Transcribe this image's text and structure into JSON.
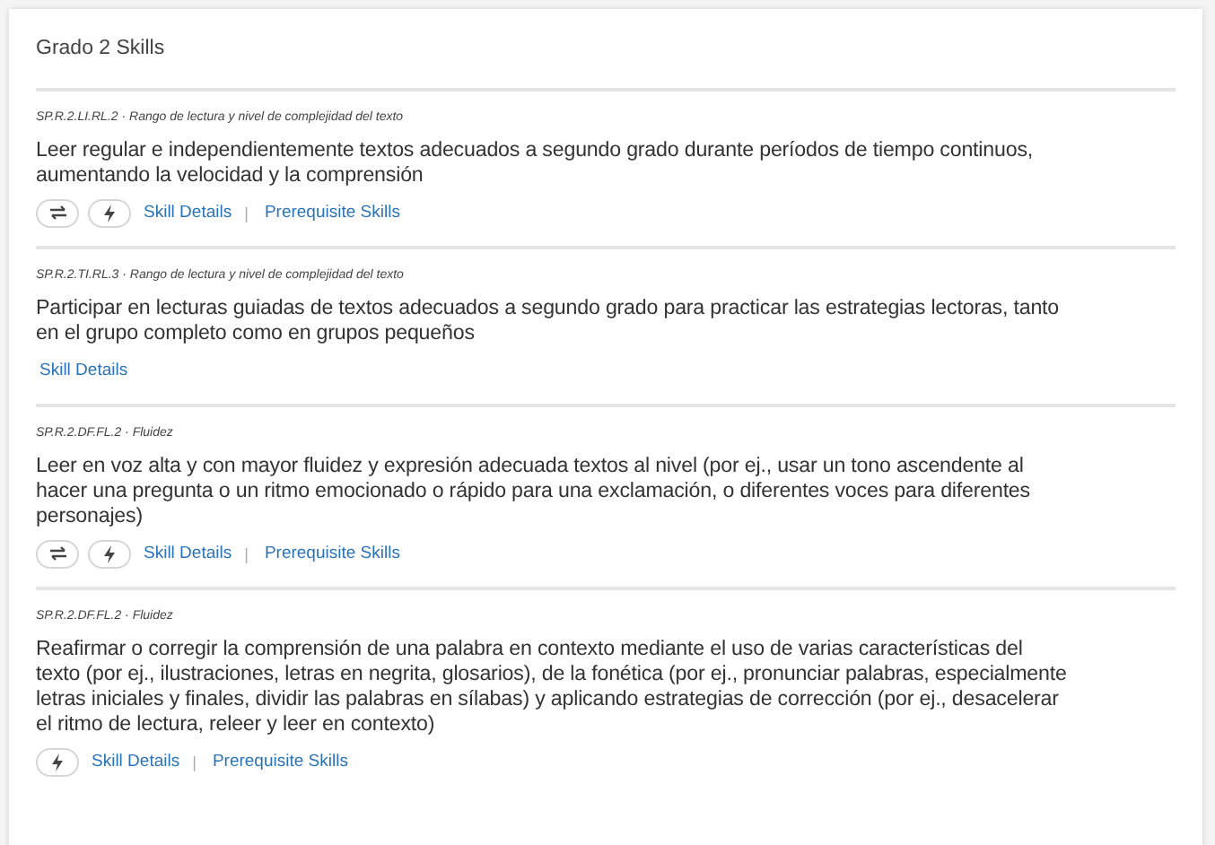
{
  "title": "Grado 2 Skills",
  "skills": [
    {
      "code": "SP.R.2.LI.RL.2 · Rango de lectura y nivel de complejidad del texto",
      "lines": [
        "Leer regular e independientemente textos adecuados a segundo grado durante períodos de tiempo continuos,",
        "aumentando la velocidad y la comprensión"
      ],
      "actions": [
        {
          "kind": "swap"
        },
        {
          "kind": "bolt"
        },
        {
          "kind": "link",
          "text": "Skill Details"
        },
        {
          "kind": "separator",
          "text": "|"
        },
        {
          "kind": "link",
          "text": "Prerequisite Skills"
        }
      ]
    },
    {
      "code": "SP.R.2.TI.RL.3 · Rango de lectura y nivel de complejidad del texto",
      "lines": [
        "Participar en lecturas guiadas de textos adecuados a segundo grado para practicar las estrategias lectoras, tanto",
        "en el grupo completo como en grupos pequeños"
      ],
      "actions": [
        {
          "kind": "link",
          "text": "Skill Details"
        }
      ]
    },
    {
      "code": "SP.R.2.DF.FL.2 · Fluidez",
      "lines": [
        "Leer en voz alta y con mayor fluidez y expresión adecuada textos al nivel (por ej., usar un tono ascendente al",
        "hacer una pregunta o un ritmo emocionado o rápido para una exclamación, o diferentes voces para diferentes",
        "personajes)"
      ],
      "actions": [
        {
          "kind": "swap"
        },
        {
          "kind": "bolt"
        },
        {
          "kind": "link",
          "text": "Skill Details"
        },
        {
          "kind": "separator",
          "text": "|"
        },
        {
          "kind": "link",
          "text": "Prerequisite Skills"
        }
      ]
    },
    {
      "code": "SP.R.2.DF.FL.2 · Fluidez",
      "lines": [
        "Reafirmar o corregir la comprensión de una palabra en contexto mediante el uso de varias características del",
        "texto (por ej., ilustraciones, letras en negrita, glosarios), de la fonética (por ej., pronunciar palabras, especialmente",
        "letras iniciales y finales, dividir las palabras en sílabas) y aplicando estrategias de corrección (por ej., desacelerar",
        "el ritmo de lectura, releer y leer en contexto)"
      ],
      "actions": [
        {
          "kind": "bolt"
        },
        {
          "kind": "link",
          "text": "Skill Details"
        },
        {
          "kind": "separator",
          "text": "|"
        },
        {
          "kind": "link",
          "text": "Prerequisite Skills"
        }
      ]
    }
  ]
}
